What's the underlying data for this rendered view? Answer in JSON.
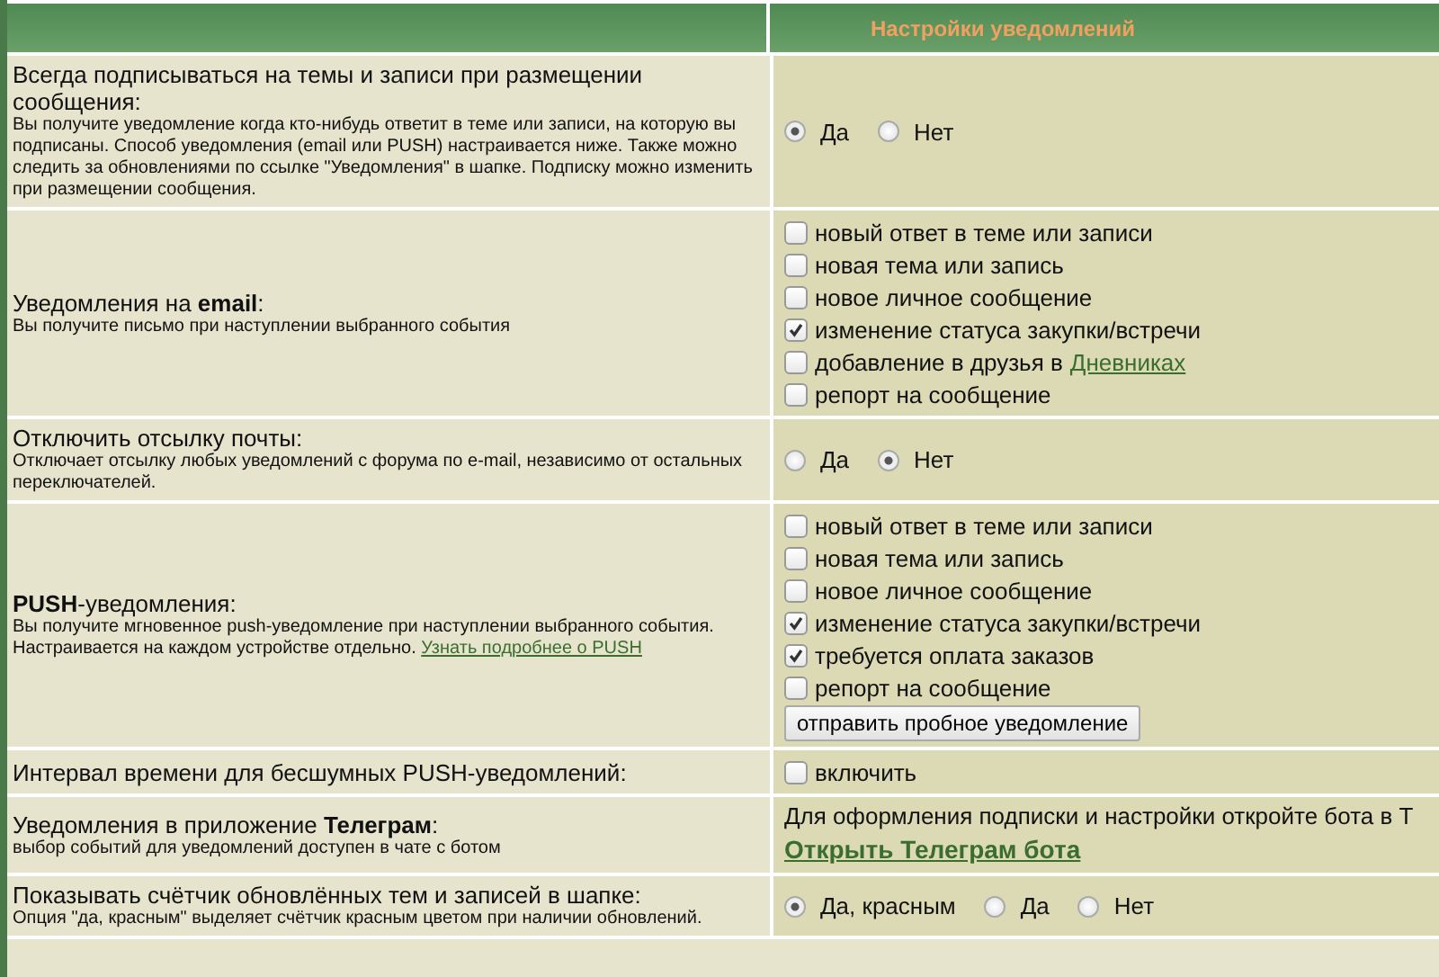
{
  "header": {
    "title": "Настройки уведомлений"
  },
  "settings": [
    {
      "kind": "radio",
      "label": "Всегда подписываться на темы и записи при размещении сообщения:",
      "description": "Вы получите уведомление когда кто-нибудь ответит в теме или записи, на которую вы подписаны. Способ уведомления (email или PUSH) настраивается ниже. Также можно следить за обновлениями по ссылке \"Уведомления\" в шапке. Подписку можно изменить при размещении сообщения.",
      "options": [
        {
          "label": "Да",
          "selected": true
        },
        {
          "label": "Нет",
          "selected": false
        }
      ]
    },
    {
      "kind": "checkboxes",
      "label": "Уведомления на **email**:",
      "description": "Вы получите письмо при наступлении выбранного события",
      "items": [
        {
          "label": "новый ответ в теме или записи",
          "checked": false
        },
        {
          "label": "новая тема или запись",
          "checked": false
        },
        {
          "label": "новое личное сообщение",
          "checked": false
        },
        {
          "label": "изменение статуса закупки/встречи",
          "checked": true
        },
        {
          "label": "добавление в друзья в",
          "link": "Дневниках",
          "checked": false
        },
        {
          "label": "репорт на сообщение",
          "checked": false
        }
      ]
    },
    {
      "kind": "radio",
      "label": "Отключить отсылку почты:",
      "description": "Отключает отсылку любых уведомлений с форума по e-mail, независимо от остальных переключателей.",
      "options": [
        {
          "label": "Да",
          "selected": false
        },
        {
          "label": "Нет",
          "selected": true
        }
      ]
    },
    {
      "kind": "checkboxes",
      "label": "**PUSH**-уведомления:",
      "description": "Вы получите мгновенное push-уведомление при наступлении выбранного события. Настраивается на каждом устройстве отдельно.",
      "description_link": "Узнать подробнее о PUSH",
      "items": [
        {
          "label": "новый ответ в теме или записи",
          "checked": false
        },
        {
          "label": "новая тема или запись",
          "checked": false
        },
        {
          "label": "новое личное сообщение",
          "checked": false
        },
        {
          "label": "изменение статуса закупки/встречи",
          "checked": true
        },
        {
          "label": "требуется оплата заказов",
          "checked": true
        },
        {
          "label": "репорт на сообщение",
          "checked": false
        }
      ],
      "button": "отправить пробное уведомление"
    },
    {
      "kind": "checkboxes",
      "label": "Интервал времени для бесшумных PUSH-уведомлений:",
      "items": [
        {
          "label": "включить",
          "checked": false
        }
      ]
    },
    {
      "kind": "telegram",
      "label": "Уведомления в приложение **Телеграм**:",
      "description": "выбор событий для уведомлений доступен в чате с ботом",
      "text": "Для оформления подписки и настройки откройте бота в Т",
      "link": "Открыть Телеграм бота"
    },
    {
      "kind": "radio",
      "label": "Показывать счётчик обновлённых тем и записей в шапке:",
      "description": "Опция \"да, красным\" выделяет счётчик красным цветом при наличии обновлений.",
      "options": [
        {
          "label": "Да, красным",
          "selected": true
        },
        {
          "label": "Да",
          "selected": false
        },
        {
          "label": "Нет",
          "selected": false
        }
      ]
    }
  ]
}
